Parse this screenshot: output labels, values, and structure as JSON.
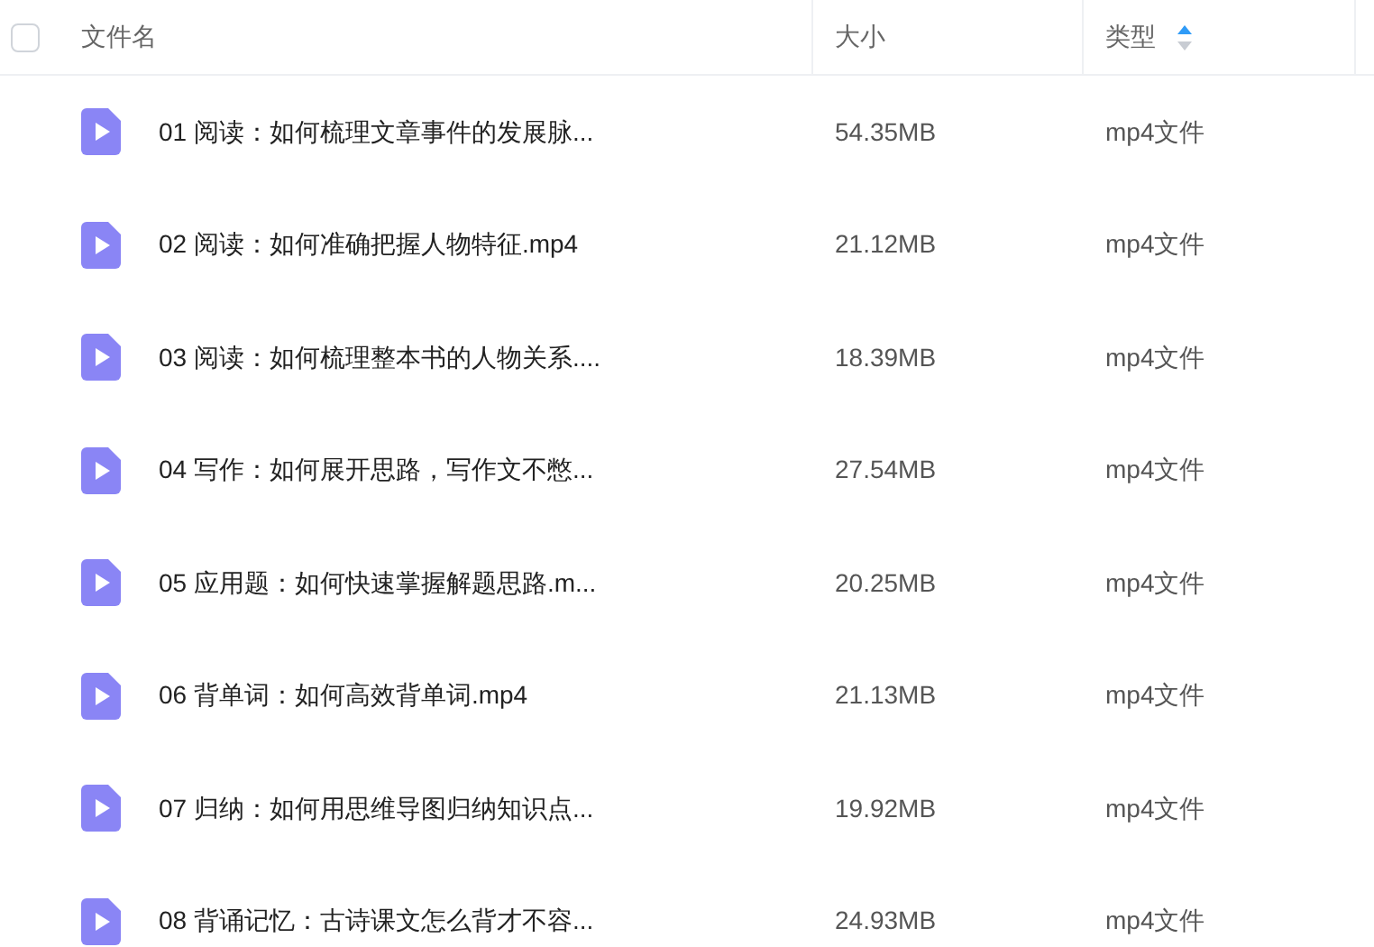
{
  "table": {
    "select_all": {
      "checked": false
    },
    "columns": [
      {
        "label": "文件名",
        "sorted": false
      },
      {
        "label": "大小",
        "sorted": false
      },
      {
        "label": "类型",
        "sorted": true
      }
    ],
    "rows": [
      {
        "name": "01 阅读：如何梳理文章事件的发展脉...",
        "size": "54.35MB",
        "type": "mp4文件"
      },
      {
        "name": "02 阅读：如何准确把握人物特征.mp4",
        "size": "21.12MB",
        "type": "mp4文件"
      },
      {
        "name": "03 阅读：如何梳理整本书的人物关系....",
        "size": "18.39MB",
        "type": "mp4文件"
      },
      {
        "name": "04 写作：如何展开思路，写作文不憋...",
        "size": "27.54MB",
        "type": "mp4文件"
      },
      {
        "name": "05 应用题：如何快速掌握解题思路.m...",
        "size": "20.25MB",
        "type": "mp4文件"
      },
      {
        "name": "06 背单词：如何高效背单词.mp4",
        "size": "21.13MB",
        "type": "mp4文件"
      },
      {
        "name": "07 归纳：如何用思维导图归纳知识点...",
        "size": "19.92MB",
        "type": "mp4文件"
      },
      {
        "name": "08 背诵记忆：古诗课文怎么背才不容...",
        "size": "24.93MB",
        "type": "mp4文件"
      }
    ]
  }
}
